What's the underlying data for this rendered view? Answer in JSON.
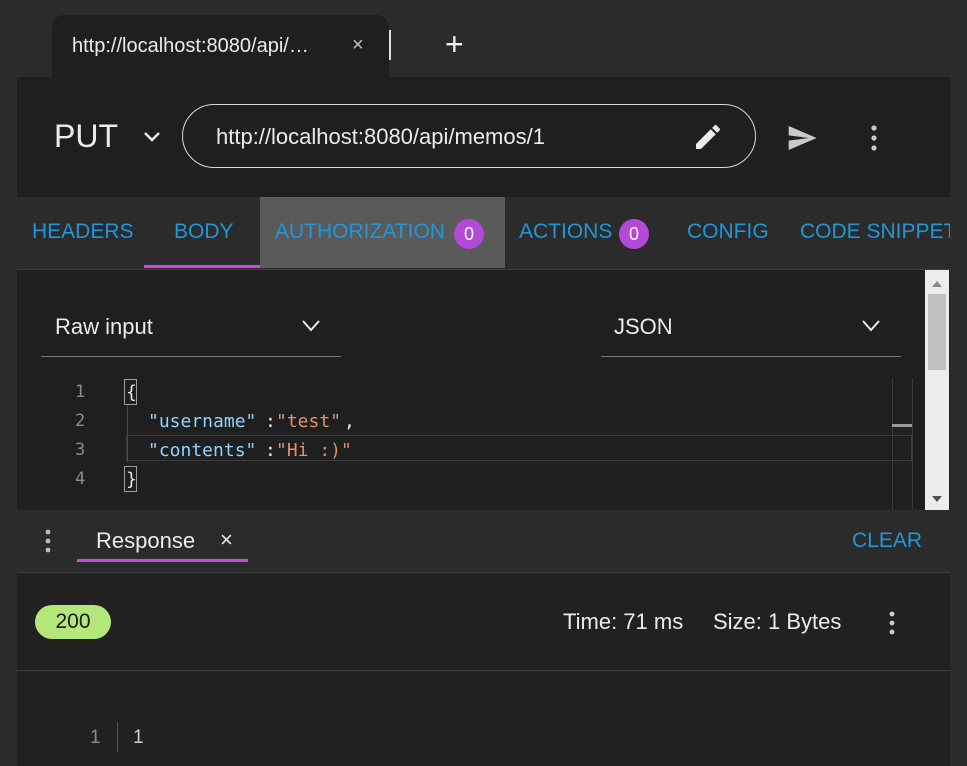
{
  "browser": {
    "tab_title": "http://localhost:8080/api/…",
    "tab_close": "×",
    "new_tab": "+"
  },
  "request": {
    "method": "PUT",
    "url": "http://localhost:8080/api/memos/1"
  },
  "tabs": [
    {
      "label": "HEADERS"
    },
    {
      "label": "BODY"
    },
    {
      "label": "AUTHORIZATION",
      "badge": "0"
    },
    {
      "label": "ACTIONS",
      "badge": "0"
    },
    {
      "label": "CONFIG"
    },
    {
      "label": "CODE SNIPPET"
    }
  ],
  "body": {
    "input_type": "Raw input",
    "content_type": "JSON",
    "line_numbers": [
      "1",
      "2",
      "3",
      "4"
    ],
    "code": {
      "open": "{",
      "key1": "\"username\"",
      "colon": ":",
      "val1": "\"test\"",
      "comma": ",",
      "key2": "\"contents\"",
      "val2": "\"Hi :)\"",
      "close": "}"
    }
  },
  "response": {
    "tab_label": "Response",
    "close": "×",
    "clear": "CLEAR",
    "status": "200",
    "time": "Time: 71 ms",
    "size": "Size: 1 Bytes",
    "line_number": "1",
    "value": "1"
  },
  "colors": {
    "accent_blue": "#2196d8",
    "accent_magenta": "#c84ae0",
    "status_green": "#b4e77a",
    "json_key": "#8fd3ff",
    "json_string": "#e0906a"
  }
}
